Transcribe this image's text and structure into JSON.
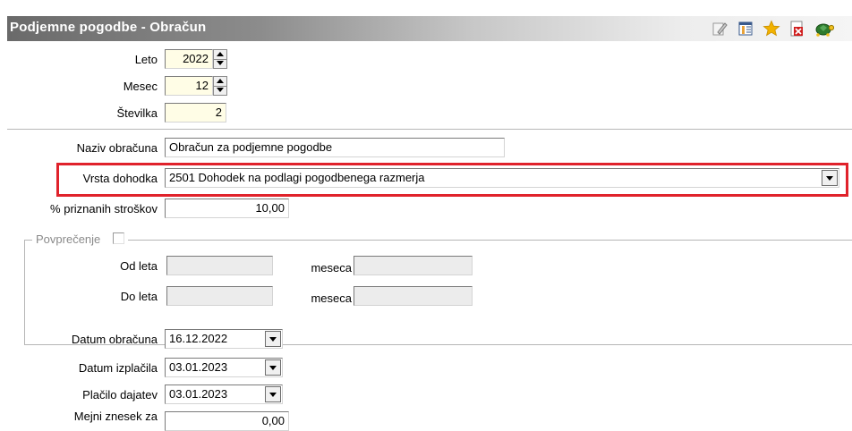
{
  "window": {
    "title": "Podjemne pogodbe - Obračun"
  },
  "toolbar": {
    "icons": [
      "edit-icon",
      "columns-icon",
      "favorite-star-icon",
      "close-document-icon",
      "turtle-icon"
    ],
    "colors": {
      "star": "#f2b200",
      "close": "#d01e1e",
      "turtle": "#2d7a2d"
    }
  },
  "form": {
    "leto": {
      "label": "Leto",
      "value": "2022"
    },
    "mesec": {
      "label": "Mesec",
      "value": "12"
    },
    "stevilka": {
      "label": "Številka",
      "value": "2"
    },
    "naziv": {
      "label": "Naziv obračuna",
      "value": "Obračun za podjemne pogodbe"
    },
    "vrsta": {
      "label": "Vrsta dohodka",
      "value": "2501  Dohodek na podlagi pogodbenega razmerja"
    },
    "stroski": {
      "label": "% priznanih stroškov",
      "value": "10,00"
    },
    "povprecenje": {
      "legend": "Povprečenje",
      "checked": false,
      "od_leta": {
        "label": "Od leta",
        "value": ""
      },
      "od_meseca": {
        "label": "meseca",
        "value": ""
      },
      "do_leta": {
        "label": "Do leta",
        "value": ""
      },
      "do_meseca": {
        "label": "meseca",
        "value": ""
      }
    },
    "datum_obracuna": {
      "label": "Datum obračuna",
      "value": "16.12.2022"
    },
    "datum_izplacila": {
      "label": "Datum izplačila",
      "value": "03.01.2023"
    },
    "placilo_dajatev": {
      "label": "Plačilo dajatev",
      "value": "03.01.2023"
    },
    "mejni_znesek": {
      "label": "Mejni znesek za",
      "value": "0,00"
    }
  },
  "colors": {
    "highlight": "#e0222b",
    "input_yellow": "#fffde6",
    "disabled": "#ececec"
  }
}
